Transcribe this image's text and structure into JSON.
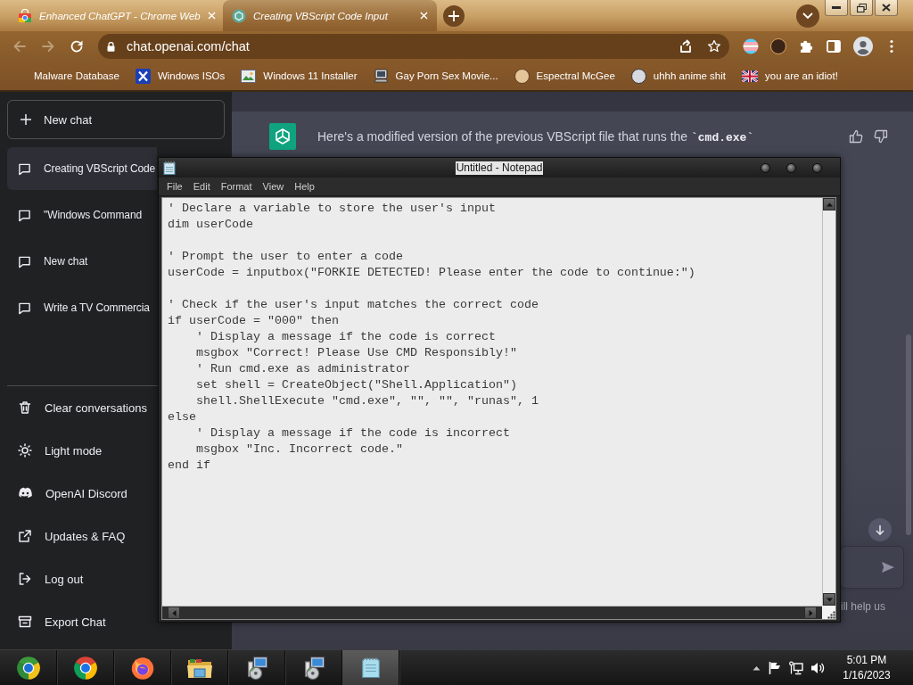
{
  "browser": {
    "tabs": [
      {
        "title": "Enhanced ChatGPT - Chrome Web",
        "selected": false
      },
      {
        "title": "Creating VBScript Code Input",
        "selected": true
      }
    ],
    "address": "chat.openai.com/chat",
    "bookmarks": [
      {
        "label": "Malware Database"
      },
      {
        "label": "Windows ISOs"
      },
      {
        "label": "Windows 11 Installer"
      },
      {
        "label": "Gay Porn Sex Movie..."
      },
      {
        "label": "Espectral McGee"
      },
      {
        "label": "uhhh anime shit"
      },
      {
        "label": "you are an idiot!"
      }
    ]
  },
  "sidebar": {
    "new_chat": "New chat",
    "history": [
      {
        "title": "Creating VBScript Code",
        "selected": true
      },
      {
        "title": "\"Windows Command",
        "selected": false
      },
      {
        "title": "New chat",
        "selected": false
      },
      {
        "title": "Write a TV Commercia",
        "selected": false
      }
    ],
    "menu": [
      {
        "kind": "clear",
        "label": "Clear conversations"
      },
      {
        "kind": "theme",
        "label": "Light mode"
      },
      {
        "kind": "discord",
        "label": "OpenAI Discord"
      },
      {
        "kind": "updates",
        "label": "Updates & FAQ"
      },
      {
        "kind": "logout",
        "label": "Log out"
      },
      {
        "kind": "export",
        "label": "Export Chat"
      }
    ]
  },
  "chat": {
    "message": "Here's a modified version of the previous VBScript file that runs the **`cmd.exe`**",
    "footer": "ill help us"
  },
  "notepad": {
    "title": "Untitled - Notepad",
    "menu": [
      "File",
      "Edit",
      "Format",
      "View",
      "Help"
    ],
    "text": "' Declare a variable to store the user's input\ndim userCode\n\n' Prompt the user to enter a code\nuserCode = inputbox(\"FORKIE DETECTED! Please enter the code to continue:\")\n\n' Check if the user's input matches the correct code\nif userCode = \"000\" then\n    ' Display a message if the code is correct\n    msgbox \"Correct! Please Use CMD Responsibly!\"\n    ' Run cmd.exe as administrator\n    set shell = CreateObject(\"Shell.Application\")\n    shell.ShellExecute \"cmd.exe\", \"\", \"\", \"runas\", 1\nelse\n    ' Display a message if the code is incorrect\n    msgbox \"Inc. Incorrect code.\"\nend if"
  },
  "taskbar": {
    "apps": [
      {
        "kind": "canary",
        "selected": false
      },
      {
        "kind": "chrome",
        "selected": false
      },
      {
        "kind": "firefox",
        "selected": false
      },
      {
        "kind": "explorer",
        "selected": false
      },
      {
        "kind": "installer",
        "selected": false
      },
      {
        "kind": "installer",
        "selected": false
      },
      {
        "kind": "notepad",
        "selected": true
      }
    ],
    "time": "5:01 PM",
    "date": "1/16/2023"
  }
}
